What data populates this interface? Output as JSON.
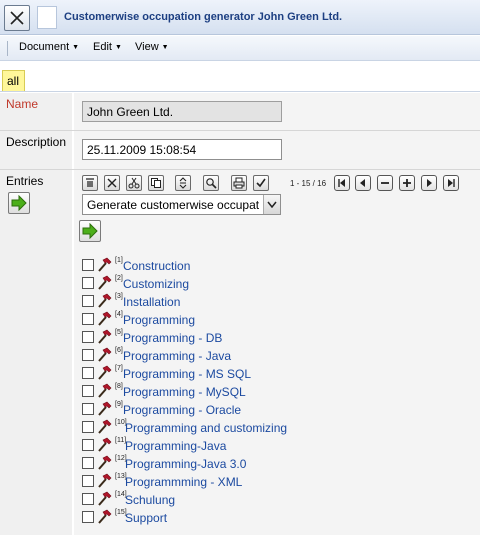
{
  "window": {
    "title": "Customerwise occupation generator John Green Ltd."
  },
  "menu": {
    "items": [
      {
        "label": "Document"
      },
      {
        "label": "Edit"
      },
      {
        "label": "View"
      }
    ]
  },
  "tabs": {
    "active": "all"
  },
  "form": {
    "name_label": "Name",
    "name_value": "John Green Ltd.",
    "description_label": "Description",
    "description_value": "25.11.2009 15:08:54",
    "entries_label": "Entries"
  },
  "toolbar": {
    "pager_text": "1 - 15 / 16",
    "action_select_value": "Generate customerwise occupat"
  },
  "entries": [
    {
      "num": "[1]",
      "label": "Construction"
    },
    {
      "num": "[2]",
      "label": "Customizing"
    },
    {
      "num": "[3]",
      "label": "Installation"
    },
    {
      "num": "[4]",
      "label": "Programming"
    },
    {
      "num": "[5]",
      "label": "Programming - DB"
    },
    {
      "num": "[6]",
      "label": "Programming - Java"
    },
    {
      "num": "[7]",
      "label": "Programming - MS SQL"
    },
    {
      "num": "[8]",
      "label": "Programming - MySQL"
    },
    {
      "num": "[9]",
      "label": "Programming - Oracle"
    },
    {
      "num": "[10]",
      "label": "Programming and customizing"
    },
    {
      "num": "[11]",
      "label": "Programming-Java"
    },
    {
      "num": "[12]",
      "label": "Programming-Java 3.0"
    },
    {
      "num": "[13]",
      "label": "Programmming - XML"
    },
    {
      "num": "[14]",
      "label": "Schulung"
    },
    {
      "num": "[15]",
      "label": "Support"
    }
  ],
  "colors": {
    "title": "#1d3f82",
    "name_label": "#c0392b",
    "link": "#1c4aa0",
    "tab_active": "#fff79a",
    "go_arrow": "#4caf1a"
  },
  "icons": {
    "entry_icon": "hammer-icon",
    "go_icon": "green-arrow-right-icon"
  }
}
